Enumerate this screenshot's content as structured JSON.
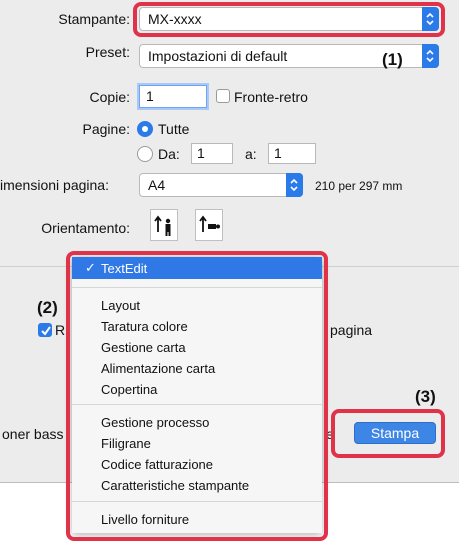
{
  "printer": {
    "label": "Stampante:",
    "value": "MX-xxxx"
  },
  "preset": {
    "label": "Preset:",
    "value": "Impostazioni di default"
  },
  "copies": {
    "label": "Copie:",
    "value": "1",
    "duplex_label": "Fronte-retro"
  },
  "pages": {
    "label": "Pagine:",
    "all_label": "Tutte",
    "from_label": "Da:",
    "from_value": "1",
    "to_label": "a:",
    "to_value": "1"
  },
  "paper_size": {
    "label": "imensioni pagina:",
    "value": "A4",
    "note": "210 per 297 mm"
  },
  "orientation": {
    "label": "Orientamento:"
  },
  "partial": {
    "left_checkbox_text": "Ri",
    "right_text": "pagina",
    "toner_text": "oner bass",
    "toner_tail": "e"
  },
  "menu": {
    "selected": "TextEdit",
    "group1": [
      "Layout",
      "Taratura colore",
      "Gestione carta",
      "Alimentazione carta",
      "Copertina"
    ],
    "group2": [
      "Gestione processo",
      "Filigrane",
      "Codice fatturazione",
      "Caratteristiche stampante"
    ],
    "group3": [
      "Livello forniture"
    ]
  },
  "print_button": {
    "label": "Stampa"
  },
  "callouts": {
    "c1": "(1)",
    "c2": "(2)",
    "c3": "(3)"
  },
  "colors": {
    "highlight": "#e0334a",
    "accent": "#2a7be9"
  }
}
